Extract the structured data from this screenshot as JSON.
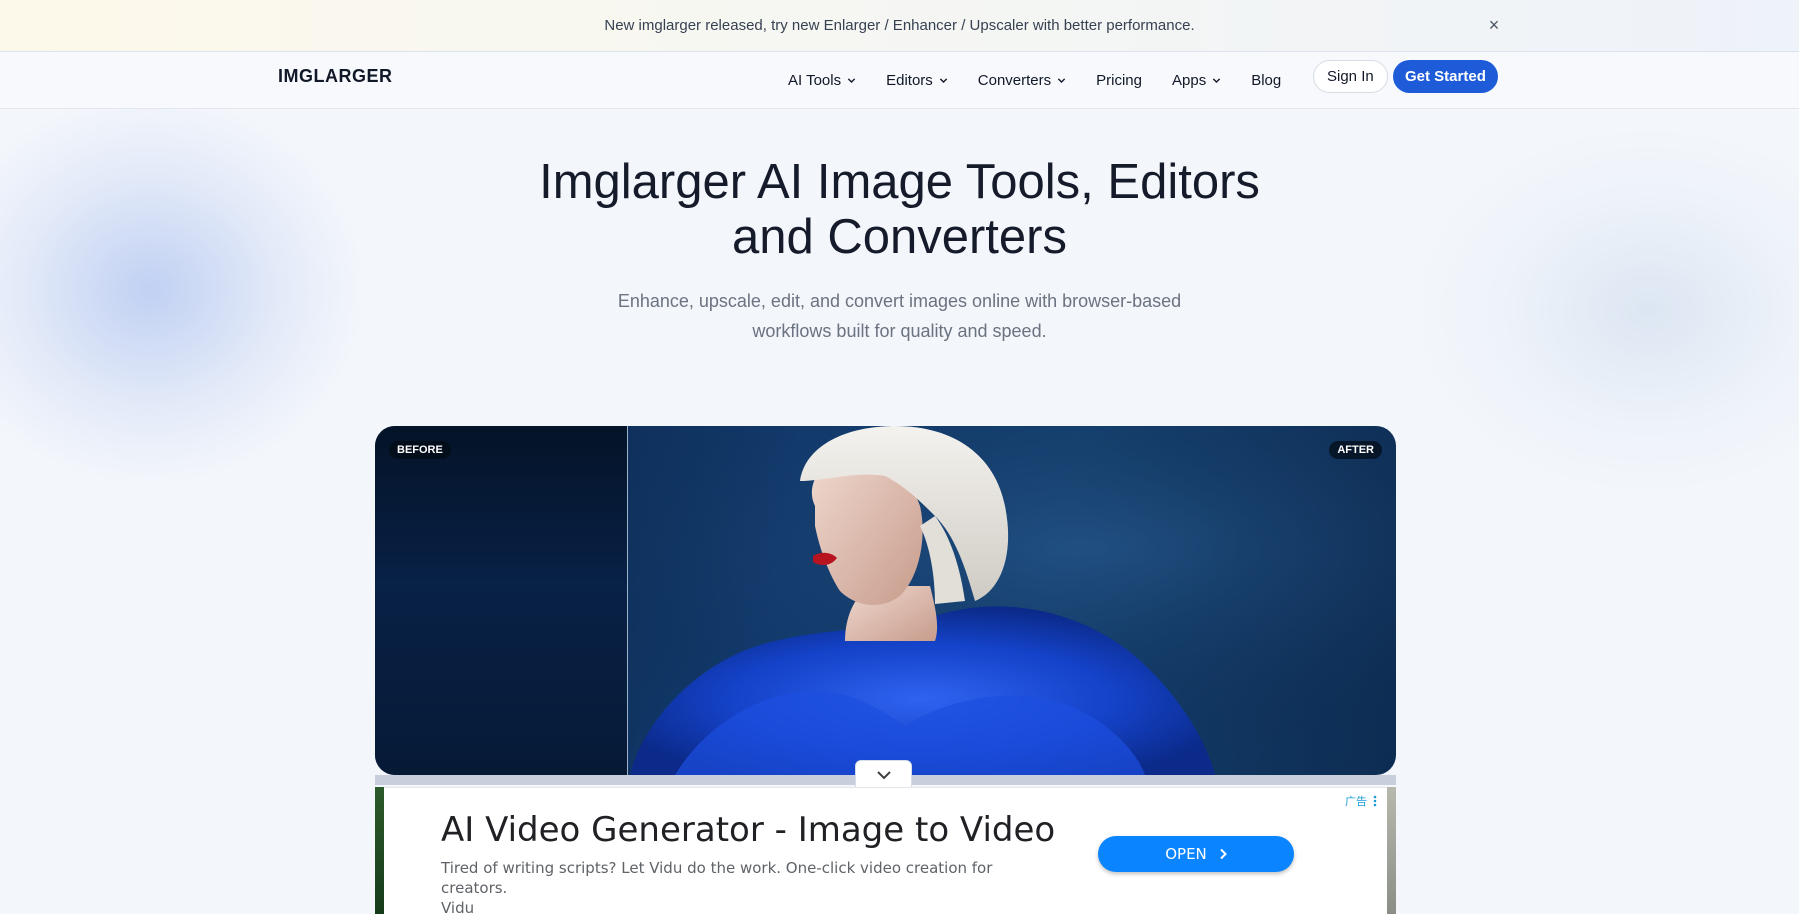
{
  "announcement": {
    "text": "New imglarger released, try new Enlarger / Enhancer / Upscaler with better performance.",
    "close_glyph": "×"
  },
  "nav": {
    "logo": "IMGLARGER",
    "items": [
      {
        "label": "AI Tools",
        "has_dropdown": true
      },
      {
        "label": "Editors",
        "has_dropdown": true
      },
      {
        "label": "Converters",
        "has_dropdown": true
      },
      {
        "label": "Pricing",
        "has_dropdown": false
      },
      {
        "label": "Apps",
        "has_dropdown": true
      },
      {
        "label": "Blog",
        "has_dropdown": false
      }
    ],
    "sign_in": "Sign In",
    "get_started": "Get Started"
  },
  "hero": {
    "title_line1": "Imglarger AI Image Tools, Editors",
    "title_line2": "and Converters",
    "subtitle_line1": "Enhance, upscale, edit, and convert images online with browser-based",
    "subtitle_line2": "workflows built for quality and speed."
  },
  "compare": {
    "before_label": "BEFORE",
    "after_label": "AFTER",
    "slider_position": 0.247
  },
  "ad": {
    "choices_label": "广告",
    "title": "AI Video Generator - Image to Video",
    "description": "Tired of writing scripts? Let Vidu do the work. One-click video creation for creators.",
    "advertiser": "Vidu",
    "cta": "OPEN"
  },
  "colors": {
    "primary": "#1d5bd8",
    "ad_button": "#0a84ff",
    "ad_choices": "#1a9bd7"
  }
}
